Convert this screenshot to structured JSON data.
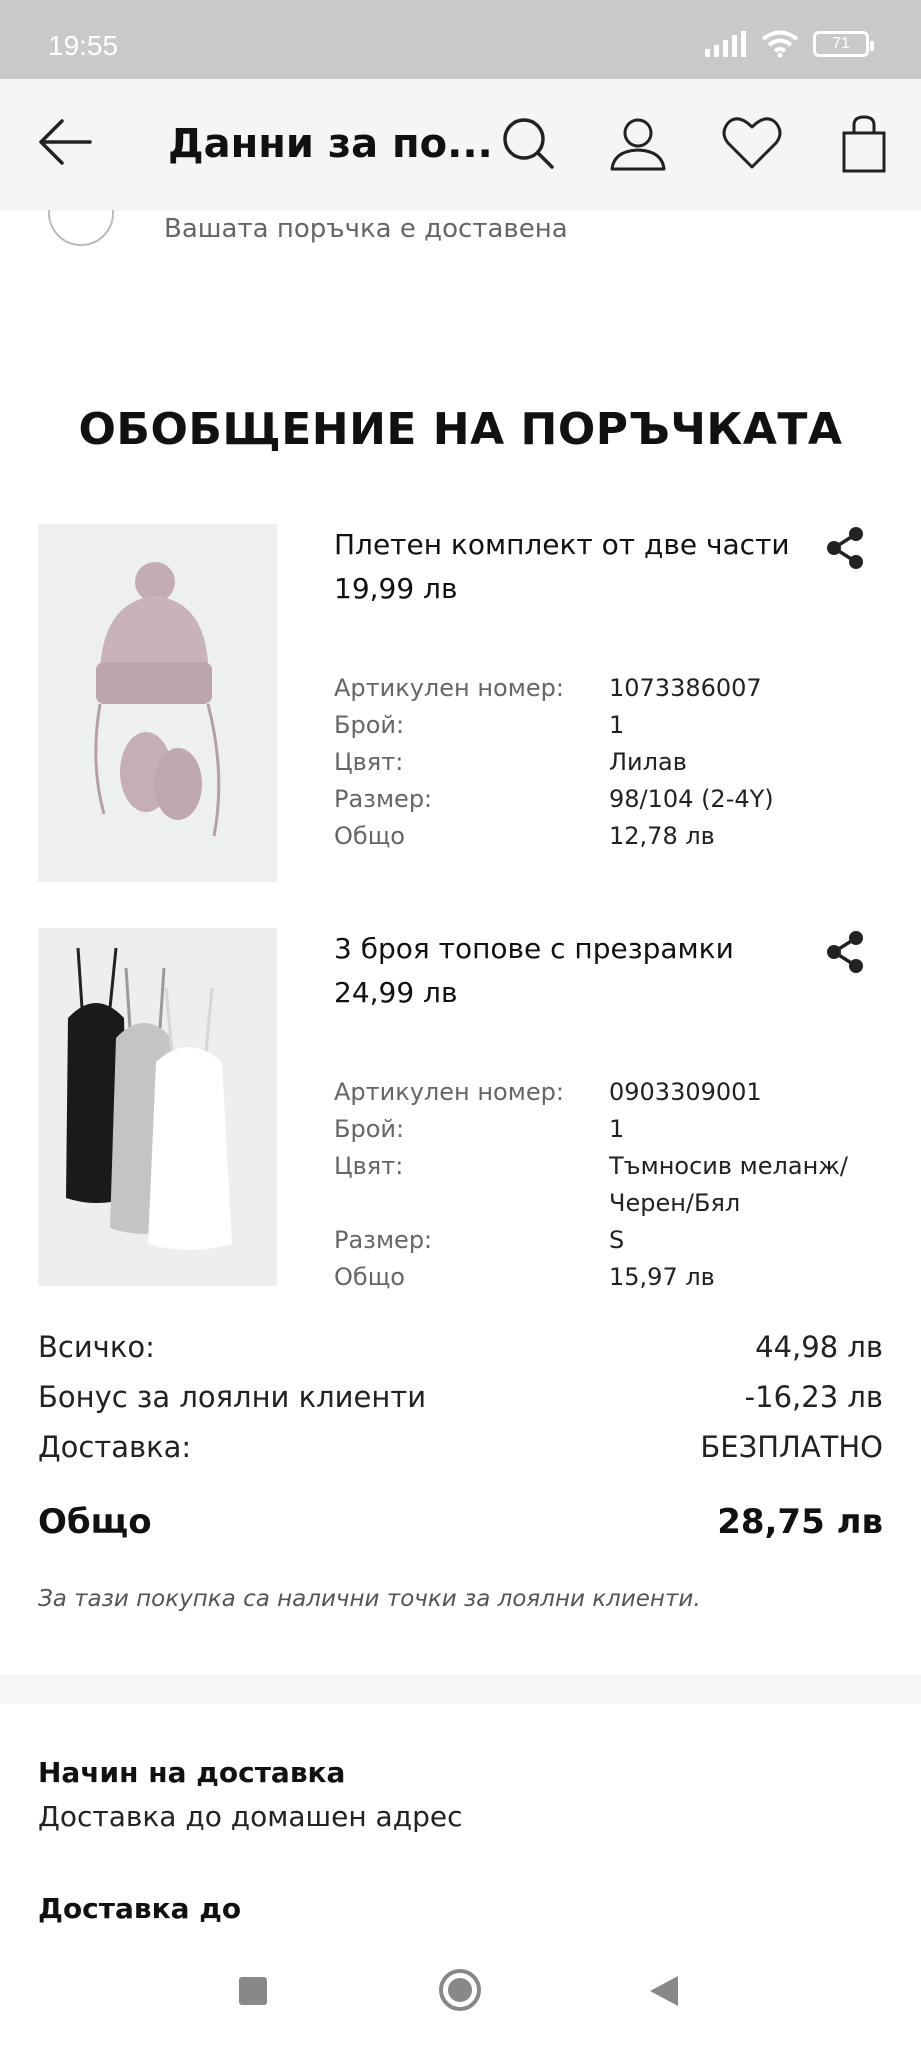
{
  "status_bar": {
    "time": "19:55",
    "battery": "71"
  },
  "header": {
    "title": "Данни за по..."
  },
  "tracking": {
    "status_text": "Вашата поръчка е доставена"
  },
  "summary": {
    "title": "ОБОБЩЕНИЕ НА ПОРЪЧКАТА"
  },
  "items": [
    {
      "name": "Плетен комплект от две части",
      "price": "19,99 лв",
      "details": [
        {
          "label": "Артикулен номер:",
          "value": "1073386007"
        },
        {
          "label": "Брой:",
          "value": "1"
        },
        {
          "label": "Цвят:",
          "value": "Лилав"
        },
        {
          "label": "Размер:",
          "value": "98/104 (2-4Y)"
        },
        {
          "label": "Общо",
          "value": "12,78 лв"
        }
      ]
    },
    {
      "name": "3 броя топове с презрамки",
      "price": "24,99 лв",
      "details": [
        {
          "label": "Артикулен номер:",
          "value": "0903309001"
        },
        {
          "label": "Брой:",
          "value": "1"
        },
        {
          "label": "Цвят:",
          "value": "Тъмносив меланж/",
          "value2": "Черен/Бял"
        },
        {
          "label": "Размер:",
          "value": "S"
        },
        {
          "label": "Общо",
          "value": "15,97 лв"
        }
      ]
    }
  ],
  "totals": {
    "subtotal_label": "Всичко:",
    "subtotal_value": "44,98 лв",
    "bonus_label": "Бонус за лоялни клиенти",
    "bonus_value": "-16,23 лв",
    "delivery_label": "Доставка:",
    "delivery_value": "БЕЗПЛАТНО",
    "total_label": "Общо",
    "total_value": "28,75 лв",
    "note": "За тази покупка са налични точки за лоялни клиенти."
  },
  "delivery": {
    "method_label": "Начин на доставка",
    "method_value": "Доставка до домашен адрес",
    "to_label": "Доставка до"
  },
  "colors": {
    "status_bar": "#c9c9c9",
    "header_bg": "#f5f5f5",
    "text": "#222222",
    "muted": "#666666"
  }
}
